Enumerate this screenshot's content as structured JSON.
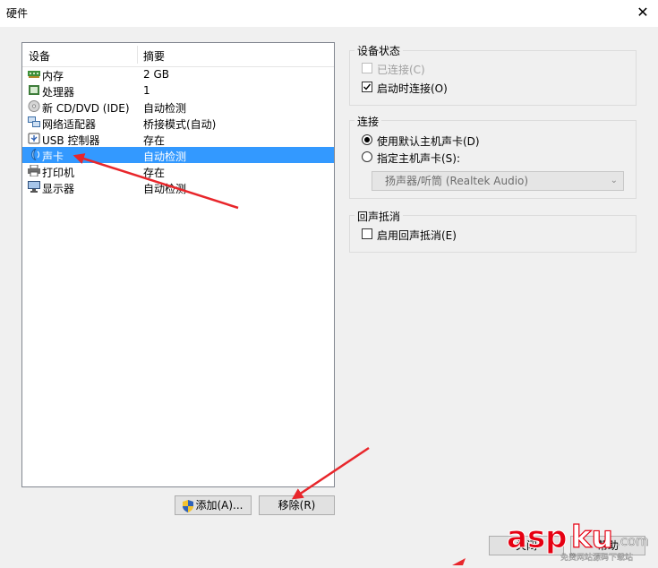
{
  "window": {
    "title": "硬件",
    "close_label": "✕"
  },
  "device_list": {
    "headers": {
      "device": "设备",
      "summary": "摘要"
    },
    "rows": [
      {
        "name": "内存",
        "summary": "2 GB",
        "icon": "memory-icon"
      },
      {
        "name": "处理器",
        "summary": "1",
        "icon": "processor-icon"
      },
      {
        "name": "新 CD/DVD (IDE)",
        "summary": "自动检测",
        "icon": "cd-dvd-icon"
      },
      {
        "name": "网络适配器",
        "summary": "桥接模式(自动)",
        "icon": "network-adapter-icon"
      },
      {
        "name": "USB 控制器",
        "summary": "存在",
        "icon": "usb-icon"
      },
      {
        "name": "声卡",
        "summary": "自动检测",
        "icon": "sound-card-icon",
        "selected": true
      },
      {
        "name": "打印机",
        "summary": "存在",
        "icon": "printer-icon"
      },
      {
        "name": "显示器",
        "summary": "自动检测",
        "icon": "display-icon"
      }
    ]
  },
  "buttons": {
    "add": "添加(A)...",
    "remove": "移除(R)",
    "close": "关闭",
    "help": "帮助"
  },
  "device_status": {
    "label": "设备状态",
    "connected": {
      "label": "已连接(C)",
      "checked": false,
      "disabled": true
    },
    "connect_at_power_on": {
      "label": "启动时连接(O)",
      "checked": true
    }
  },
  "connection": {
    "label": "连接",
    "use_default": {
      "label": "使用默认主机声卡(D)",
      "selected": true
    },
    "specify": {
      "label": "指定主机声卡(S):",
      "selected": false
    },
    "host_sound_card": {
      "value": "扬声器/听筒 (Realtek Audio)",
      "disabled": true
    }
  },
  "echo_cancellation": {
    "label": "回声抵消",
    "enable": {
      "label": "启用回声抵消(E)",
      "checked": false
    }
  },
  "watermark": {
    "brand": "aspku",
    "suffix": ".com",
    "caption": "免费网站源码下载站"
  },
  "colors": {
    "selection": "#3399ff",
    "arrow": "#e8262b",
    "watermark": "#e60012"
  }
}
